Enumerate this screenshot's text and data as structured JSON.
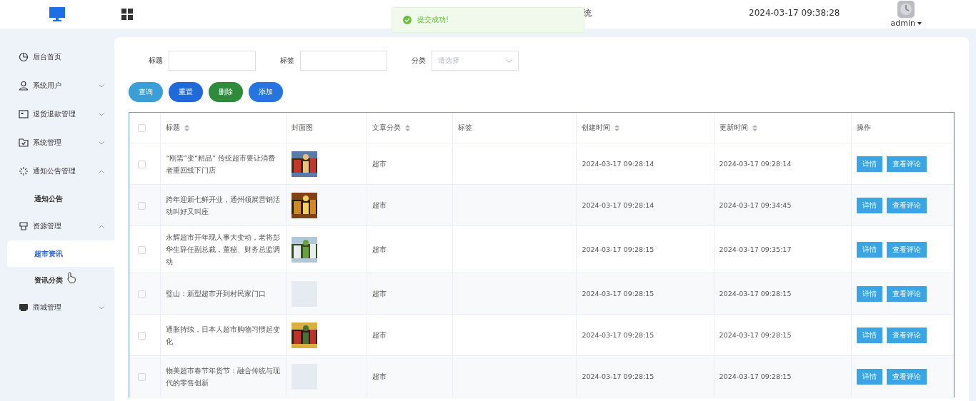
{
  "header": {
    "title_fragment": "统",
    "datetime": "2024-03-17 09:38:28",
    "user": "admin"
  },
  "toast": {
    "message": "提交成功!"
  },
  "sidebar": {
    "items": [
      {
        "label": "后台首页"
      },
      {
        "label": "系统用户",
        "expanded": false
      },
      {
        "label": "退货退款管理",
        "expanded": false
      },
      {
        "label": "系统管理",
        "expanded": false
      },
      {
        "label": "通知公告管理",
        "expanded": true,
        "children": [
          {
            "label": "通知公告",
            "selected": false
          }
        ]
      },
      {
        "label": "资源管理",
        "expanded": true,
        "children": [
          {
            "label": "超市资讯",
            "selected": true
          },
          {
            "label": "资讯分类",
            "selected": false
          }
        ]
      },
      {
        "label": "商城管理",
        "expanded": false
      }
    ]
  },
  "filters": [
    {
      "label": "标题",
      "kind": "text"
    },
    {
      "label": "标签",
      "kind": "text"
    },
    {
      "label": "分类",
      "kind": "select",
      "placeholder": "请选择"
    }
  ],
  "buttons": [
    {
      "label": "查询",
      "color": "#3a9fd8"
    },
    {
      "label": "重置",
      "color": "#1f6ad8"
    },
    {
      "label": "删除",
      "color": "#2e8b3c"
    },
    {
      "label": "添加",
      "color": "#2574e0"
    }
  ],
  "table": {
    "select_all": {
      "checked": false
    },
    "columns": [
      {
        "label": "标题",
        "sortable": true
      },
      {
        "label": "封面图",
        "sortable": false
      },
      {
        "label": "文章分类",
        "sortable": true
      },
      {
        "label": "标签",
        "sortable": false
      },
      {
        "label": "创建时间",
        "sortable": true
      },
      {
        "label": "更新时间",
        "sortable": true
      },
      {
        "label": "操作",
        "sortable": false
      }
    ],
    "rows": [
      {
        "checked": false,
        "title": "“刚需”变“精品” 传统超市要让消费者重回线下门店",
        "cover": {
          "kind": "picture"
        },
        "category": "超市",
        "created": "2024-03-17 09:28:14",
        "updated": "2024-03-17 09:28:14",
        "actions": [
          "详情",
          "查看评论"
        ]
      },
      {
        "checked": false,
        "title": "跨年迎新七鲜开业，通州领展营销活动叫好又叫座",
        "cover": {
          "kind": "picture"
        },
        "category": "超市",
        "created": "2024-03-17 09:28:14",
        "updated": "2024-03-17 09:34:45",
        "actions": [
          "详情",
          "查看评论"
        ]
      },
      {
        "checked": false,
        "title": "永辉超市开年现人事大变动，老将彭华生辞任副总裁，董秘、财务总监调动",
        "cover": {
          "kind": "picture"
        },
        "category": "超市",
        "created": "2024-03-17 09:28:15",
        "updated": "2024-03-17 09:35:17",
        "actions": [
          "详情",
          "查看评论"
        ]
      },
      {
        "checked": false,
        "title": "璧山：新型超市开到村民家门口",
        "cover": {
          "kind": "empty"
        },
        "category": "超市",
        "created": "2024-03-17 09:28:15",
        "updated": "2024-03-17 09:28:15",
        "actions": [
          "详情",
          "查看评论"
        ]
      },
      {
        "checked": false,
        "title": "通胀持续，日本人超市购物习惯起变化",
        "cover": {
          "kind": "picture"
        },
        "category": "超市",
        "created": "2024-03-17 09:28:15",
        "updated": "2024-03-17 09:28:15",
        "actions": [
          "详情",
          "查看评论"
        ]
      },
      {
        "checked": false,
        "title": "物美超市春节年货节：融合传统与现代的零售创新",
        "cover": {
          "kind": "empty"
        },
        "category": "超市",
        "created": "2024-03-17 09:28:15",
        "updated": "2024-03-17 09:28:15",
        "actions": [
          "详情",
          "查看评论"
        ]
      }
    ]
  }
}
